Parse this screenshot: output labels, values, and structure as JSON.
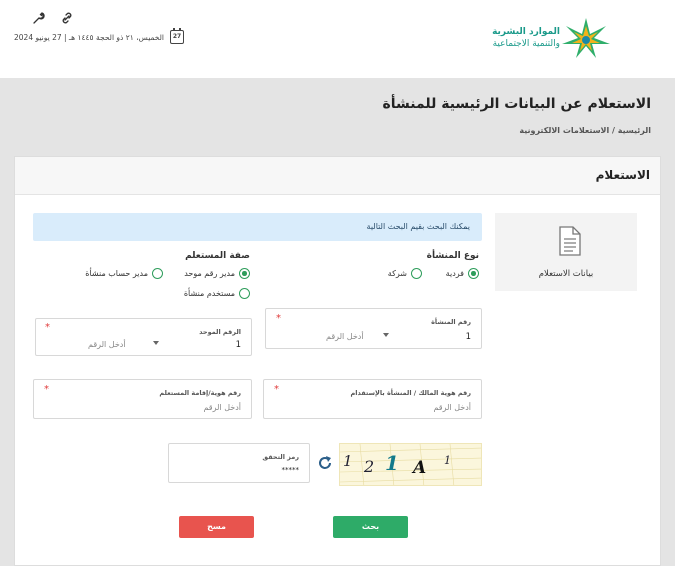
{
  "header": {
    "logo": {
      "line1": "الموارد البشرية",
      "line2": "والتنمية الاجتماعية",
      "icon": "mhrsd-logo"
    },
    "date": "الخميس، ٢١ ذو الحجة ١٤٤٥ هـ | 27 يونيو 2024",
    "calendar_day": "27",
    "icons": [
      "link-icon",
      "wrench-icon",
      "calendar-icon"
    ]
  },
  "page": {
    "title": "الاستعلام عن البيانات الرئيسية للمنشأة",
    "breadcrumb": "الرئيسية / الاستعلامات الالكترونية"
  },
  "card": {
    "title": "الاستعلام",
    "side_tab": {
      "label": "بيانات الاستعلام",
      "icon": "document-icon"
    },
    "info": "يمكنك البحث بقيم البحث التالية",
    "establishment_type": {
      "title": "نوع المنشأة",
      "options": [
        {
          "label": "فردية",
          "selected": true
        },
        {
          "label": "شركة",
          "selected": false
        }
      ]
    },
    "user_role": {
      "title": "صفة المستعلم",
      "options": [
        {
          "label": "مدير رقم موحد",
          "selected": true
        },
        {
          "label": "مدير حساب منشأة",
          "selected": false
        },
        {
          "label": "مستخدم منشأة",
          "selected": false
        }
      ]
    },
    "fields": {
      "establishment_number": {
        "label": "رقم المنشأة",
        "select_value": "1",
        "placeholder": "أدخل الرقم"
      },
      "unified_number": {
        "label": "الرقم الموحد",
        "select_value": "1",
        "placeholder": "أدخل الرقم"
      },
      "owner_id": {
        "label": "رقم هوية المالك / المنشأة بالإستقدام",
        "placeholder": "أدخل الرقم"
      },
      "user_id": {
        "label": "رقم هوية/إقامة المستعلم",
        "placeholder": "أدخل الرقم"
      },
      "captcha": {
        "label": "رمز التحقق",
        "value": "*****"
      }
    },
    "captcha_chars": [
      "1",
      "A",
      "1",
      "2",
      "1"
    ],
    "buttons": {
      "search": "بحث",
      "clear": "مسح"
    }
  },
  "colors": {
    "primary_green": "#2eab68",
    "danger_red": "#e8544e",
    "info_bg": "#d9ecfb",
    "logo_teal": "#1a9a8a"
  }
}
